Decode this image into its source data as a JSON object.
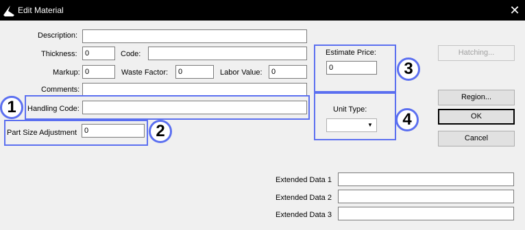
{
  "window": {
    "title": "Edit Material",
    "close_icon": "close-icon",
    "logo_icon": "app-logo-icon"
  },
  "form": {
    "description_label": "Description:",
    "description_value": "",
    "thickness_label": "Thickness:",
    "thickness_value": "0",
    "code_label": "Code:",
    "code_value": "",
    "markup_label": "Markup:",
    "markup_value": "0",
    "waste_factor_label": "Waste Factor:",
    "waste_factor_value": "0",
    "labor_value_label": "Labor Value:",
    "labor_value_value": "0",
    "comments_label": "Comments:",
    "comments_value": "",
    "handling_code_label": "Handling Code:",
    "handling_code_value": "",
    "part_size_label": "Part Size Adjustment",
    "part_size_value": "0",
    "estimate_price_label": "Estimate Price:",
    "estimate_price_value": "0",
    "unit_type_label": "Unit Type:",
    "unit_type_value": "",
    "extended_1_label": "Extended Data 1",
    "extended_1_value": "",
    "extended_2_label": "Extended Data 2",
    "extended_2_value": "",
    "extended_3_label": "Extended Data 3",
    "extended_3_value": ""
  },
  "buttons": {
    "hatching": "Hatching...",
    "region": "Region...",
    "ok": "OK",
    "cancel": "Cancel"
  },
  "annotations": {
    "badge1": "1",
    "badge2": "2",
    "badge3": "3",
    "badge4": "4",
    "highlight_color": "#5b6ff0"
  }
}
